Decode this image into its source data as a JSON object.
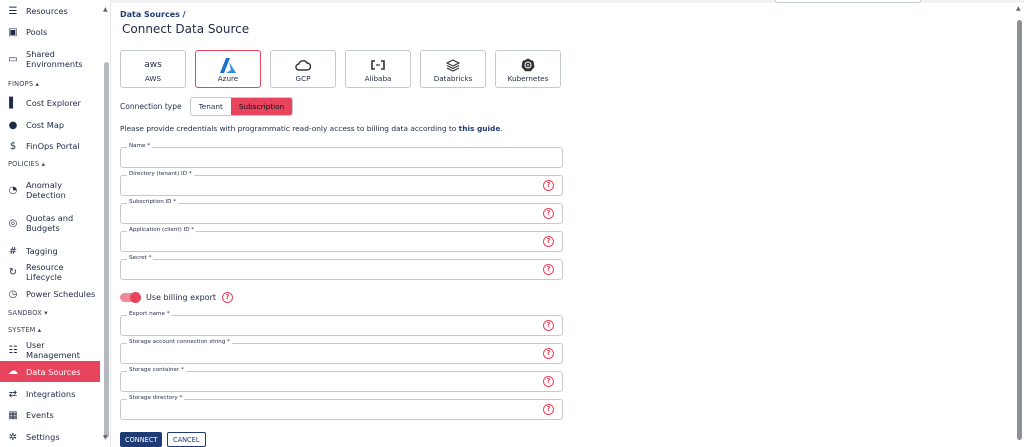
{
  "sidebar": {
    "items": [
      {
        "label": "Resources",
        "icon": "list-icon"
      },
      {
        "label": "Pools",
        "icon": "pool-icon"
      },
      {
        "label": "Shared Environments",
        "icon": "monitor-icon"
      },
      {
        "label": "Cost Explorer",
        "icon": "bar-chart-icon"
      },
      {
        "label": "Cost Map",
        "icon": "globe-icon"
      },
      {
        "label": "FinOps Portal",
        "icon": "dollar-icon"
      },
      {
        "label": "Anomaly Detection",
        "icon": "speedometer-icon"
      },
      {
        "label": "Quotas and Budgets",
        "icon": "budget-icon"
      },
      {
        "label": "Tagging",
        "icon": "hashtag-icon"
      },
      {
        "label": "Resource Lifecycle",
        "icon": "lifecycle-icon"
      },
      {
        "label": "Power Schedules",
        "icon": "clock-icon"
      },
      {
        "label": "User Management",
        "icon": "users-icon"
      },
      {
        "label": "Data Sources",
        "icon": "cloud-icon"
      },
      {
        "label": "Integrations",
        "icon": "arrows-icon"
      },
      {
        "label": "Events",
        "icon": "calendar-icon"
      },
      {
        "label": "Settings",
        "icon": "gear-icon"
      }
    ],
    "sections": {
      "finops": "FINOPS ▴",
      "policies": "POLICIES ▴",
      "sandbox": "SANDBOX ▾",
      "system": "SYSTEM ▴"
    },
    "active_item": "Data Sources"
  },
  "main": {
    "breadcrumb": "Data Sources /",
    "title": "Connect Data Source",
    "providers": [
      {
        "label": "AWS",
        "logo_text": "aws",
        "selected": false
      },
      {
        "label": "Azure",
        "logo_text": "",
        "selected": true
      },
      {
        "label": "GCP",
        "logo_text": "",
        "selected": false
      },
      {
        "label": "Alibaba",
        "logo_text": "",
        "selected": false
      },
      {
        "label": "Databricks",
        "logo_text": "",
        "selected": false
      },
      {
        "label": "Kubernetes",
        "logo_text": "",
        "selected": false
      }
    ],
    "connection_type_label": "Connection type",
    "connection_types": [
      "Tenant",
      "Subscription"
    ],
    "connection_type_selected": "Subscription",
    "info_text": "Please provide credentials with programmatic read-only access to billing data according to",
    "info_link": "this guide",
    "info_tail": ".",
    "fields": [
      {
        "label": "Name *",
        "value": "",
        "help": false
      },
      {
        "label": "Directory (tenant) ID *",
        "value": "",
        "help": true
      },
      {
        "label": "Subscription ID *",
        "value": "",
        "help": true
      },
      {
        "label": "Application (client) ID *",
        "value": "",
        "help": true
      },
      {
        "label": "Secret *",
        "value": "",
        "help": true
      }
    ],
    "billing_toggle_label": "Use billing export",
    "billing_toggle_on": true,
    "export_fields": [
      {
        "label": "Export name *",
        "value": "",
        "help": true
      },
      {
        "label": "Storage account connection string *",
        "value": "",
        "help": true
      },
      {
        "label": "Storage container *",
        "value": "",
        "help": true
      },
      {
        "label": "Storage directory *",
        "value": "",
        "help": true
      }
    ],
    "help_glyph": "?",
    "connect_label": "CONNECT",
    "cancel_label": "CANCEL"
  },
  "colors": {
    "accent": "#e8445e",
    "primary": "#1f3b73"
  }
}
